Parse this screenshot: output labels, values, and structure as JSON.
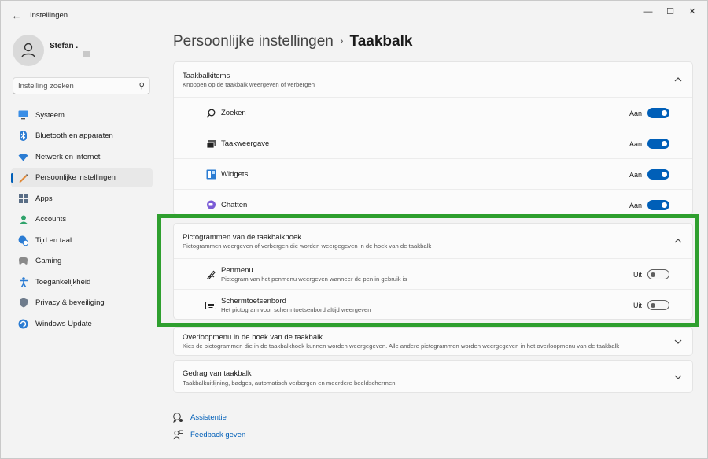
{
  "window": {
    "title": "Instellingen",
    "back_icon": "arrow-left-icon",
    "controls": [
      "minimize-icon",
      "maximize-icon",
      "close-icon"
    ]
  },
  "user": {
    "name": "Stefan ."
  },
  "search": {
    "placeholder": "Instelling zoeken",
    "icon": "search-icon"
  },
  "nav": {
    "items": [
      {
        "label": "Systeem",
        "icon": "monitor-icon"
      },
      {
        "label": "Bluetooth en apparaten",
        "icon": "bluetooth-icon"
      },
      {
        "label": "Netwerk en internet",
        "icon": "wifi-icon"
      },
      {
        "label": "Persoonlijke instellingen",
        "icon": "pen-icon",
        "active": true
      },
      {
        "label": "Apps",
        "icon": "apps-icon"
      },
      {
        "label": "Accounts",
        "icon": "person-icon"
      },
      {
        "label": "Tijd en taal",
        "icon": "globe-clock-icon"
      },
      {
        "label": "Gaming",
        "icon": "gamepad-icon"
      },
      {
        "label": "Toegankelijkheid",
        "icon": "accessibility-icon"
      },
      {
        "label": "Privacy & beveiliging",
        "icon": "shield-icon"
      },
      {
        "label": "Windows Update",
        "icon": "update-icon"
      }
    ]
  },
  "breadcrumb": {
    "parent": "Persoonlijke instellingen",
    "separator": "›",
    "current": "Taakbalk"
  },
  "sections": {
    "taskbar_items": {
      "title": "Taakbalkitems",
      "subtitle": "Knoppen op de taakbalk weergeven of verbergen",
      "rows": [
        {
          "label": "Zoeken",
          "state": "Aan",
          "icon": "search-icon"
        },
        {
          "label": "Taakweergave",
          "state": "Aan",
          "icon": "task-view-icon"
        },
        {
          "label": "Widgets",
          "state": "Aan",
          "icon": "widgets-icon"
        },
        {
          "label": "Chatten",
          "state": "Aan",
          "icon": "chat-icon"
        }
      ]
    },
    "corner_icons": {
      "title": "Pictogrammen van de taakbalkhoek",
      "subtitle": "Pictogrammen weergeven of verbergen die worden weergegeven in de hoek van de taakbalk",
      "rows": [
        {
          "label": "Penmenu",
          "desc": "Pictogram van het penmenu weergeven wanneer de pen in gebruik is",
          "state": "Uit",
          "icon": "pen-menu-icon"
        },
        {
          "label": "Schermtoetsenbord",
          "desc": "Het pictogram voor schermtoetsenbord altijd weergeven",
          "state": "Uit",
          "icon": "keyboard-icon"
        }
      ]
    },
    "overflow": {
      "title": "Overloopmenu in de hoek van de taakbalk",
      "subtitle": "Kies de pictogrammen die in de taakbalkhoek kunnen worden weergegeven. Alle andere pictogrammen worden weergegeven in het overloopmenu van de taakbalk"
    },
    "behavior": {
      "title": "Gedrag van taakbalk",
      "subtitle": "Taakbalkuitlijning, badges, automatisch verbergen en meerdere beeldschermen"
    }
  },
  "footer": {
    "help": "Assistentie",
    "feedback": "Feedback geven"
  },
  "colors": {
    "accent": "#005fb8",
    "highlight": "#2e9f2e"
  }
}
